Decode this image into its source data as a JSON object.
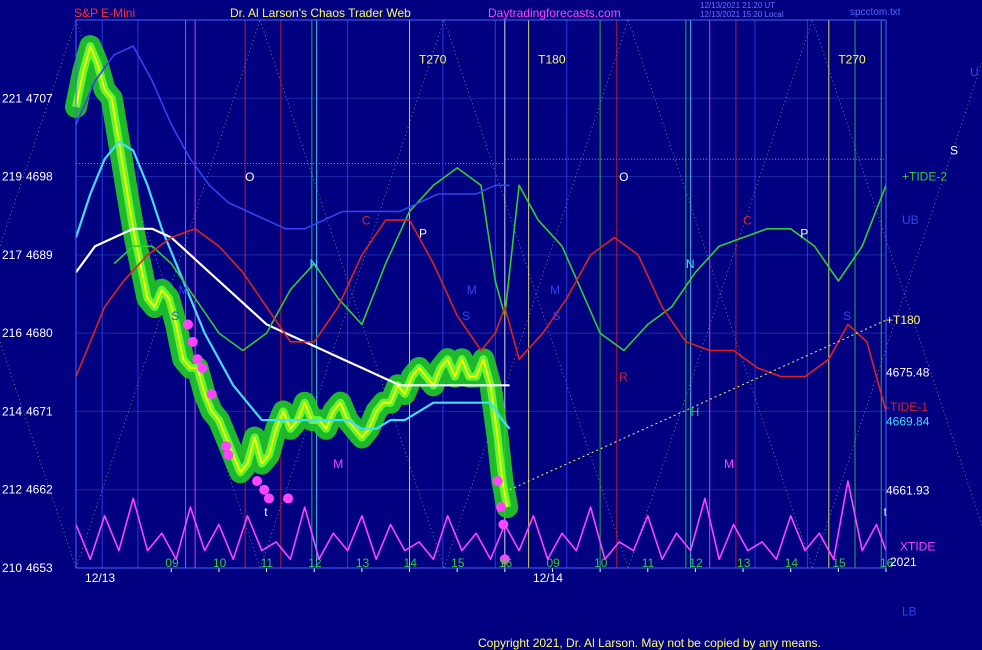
{
  "header": {
    "symbol": "S&P E-Mini",
    "title": "Dr. Al Larson's Chaos Trader Web",
    "site": "Daytradingforecasts.com",
    "timestamp_1": "12/13/2021 21:20 UT",
    "timestamp_2": "12/13/2021 15:20 Local",
    "file": "spcctom.txt"
  },
  "footer": {
    "copyright": "Copyright 2021, Dr. Al Larson. May not be copied by any means."
  },
  "colors": {
    "background": "#000080",
    "grid": "#1a2aa8",
    "frame": "#4466ff",
    "yellow": "#ffff66",
    "cyan": "#44ddff",
    "white": "#ffffff",
    "green": "#33cc33",
    "red": "#dd2222",
    "magenta": "#ff44ff",
    "blue": "#3344ee",
    "glow": "#22cc22",
    "price_line": "#ffff00",
    "dot": "#ff44ff"
  },
  "chart_data": {
    "type": "line",
    "title": "S&P E-Mini",
    "ylim": [
      4653,
      4716
    ],
    "y_ticks": [
      {
        "value": 4707,
        "left": "221",
        "label": "4707"
      },
      {
        "value": 4698,
        "left": "219",
        "label": "4698"
      },
      {
        "value": 4689,
        "left": "217",
        "label": "4689"
      },
      {
        "value": 4680,
        "left": "216",
        "label": "4680"
      },
      {
        "value": 4671,
        "left": "214",
        "label": "4671"
      },
      {
        "value": 4662,
        "left": "212",
        "label": "4662"
      },
      {
        "value": 4653,
        "left": "210",
        "label": "4653"
      }
    ],
    "x_ticks": [
      {
        "x": 3.0,
        "label": "09"
      },
      {
        "x": 4.0,
        "label": "10"
      },
      {
        "x": 5.0,
        "label": "11"
      },
      {
        "x": 6.0,
        "label": "12"
      },
      {
        "x": 7.0,
        "label": "13"
      },
      {
        "x": 8.0,
        "label": "14"
      },
      {
        "x": 9.0,
        "label": "15"
      },
      {
        "x": 10.0,
        "label": "16"
      },
      {
        "x": 11.0,
        "label": "09"
      },
      {
        "x": 12.0,
        "label": "10"
      },
      {
        "x": 13.0,
        "label": "11"
      },
      {
        "x": 14.0,
        "label": "12"
      },
      {
        "x": 15.0,
        "label": "13"
      },
      {
        "x": 16.0,
        "label": "14"
      },
      {
        "x": 17.0,
        "label": "15"
      },
      {
        "x": 18.0,
        "label": "16"
      }
    ],
    "dates": [
      {
        "x": 1.4,
        "label": "12/13"
      },
      {
        "x": 10.8,
        "label": "12/14"
      }
    ],
    "year": "2021",
    "xlim": [
      1.0,
      18.0
    ],
    "right_labels": [
      {
        "text": "U",
        "value": 4710,
        "color": "#3344ee"
      },
      {
        "text": "S",
        "value": 4701,
        "color": "#ffffff"
      },
      {
        "text": "+TIDE-2",
        "value": 4698,
        "color": "#33cc33"
      },
      {
        "text": "UB",
        "value": 4693,
        "color": "#3344ee"
      },
      {
        "text": "+T180",
        "value": 4681.5,
        "color": "#ffff66"
      },
      {
        "text": "4675.48",
        "value": 4675.48,
        "color": "#ffffff"
      },
      {
        "text": "-TIDE-1",
        "value": 4671.5,
        "color": "#dd2222"
      },
      {
        "text": "4669.84",
        "value": 4669.84,
        "color": "#44ddff"
      },
      {
        "text": "4661.93",
        "value": 4661.93,
        "color": "#ffffff"
      },
      {
        "text": "XTIDE",
        "value": 4655.5,
        "color": "#ff44ff"
      },
      {
        "text": "LB",
        "value": 4648,
        "color": "#3344ee"
      }
    ],
    "chart_labels": [
      {
        "text": "T270",
        "x": 8.2,
        "value": 4711,
        "color": "#ffff66"
      },
      {
        "text": "T180",
        "x": 10.7,
        "value": 4711,
        "color": "#ffff66"
      },
      {
        "text": "T270",
        "x": 17.0,
        "value": 4711,
        "color": "#ffff66"
      },
      {
        "text": "O",
        "x": 4.55,
        "value": 4697.5,
        "color": "#ffffff"
      },
      {
        "text": "O",
        "x": 12.4,
        "value": 4697.5,
        "color": "#ffffff"
      },
      {
        "text": "C",
        "x": 7.0,
        "value": 4692.5,
        "color": "#dd2222"
      },
      {
        "text": "C",
        "x": 15.0,
        "value": 4692.5,
        "color": "#dd2222"
      },
      {
        "text": "P",
        "x": 8.2,
        "value": 4691,
        "color": "#ffffff"
      },
      {
        "text": "P",
        "x": 16.2,
        "value": 4691,
        "color": "#ffffff"
      },
      {
        "text": "N",
        "x": 5.9,
        "value": 4687.5,
        "color": "#44ddff"
      },
      {
        "text": "N",
        "x": 13.8,
        "value": 4687.5,
        "color": "#44ddff"
      },
      {
        "text": "M",
        "x": 3.15,
        "value": 4684.5,
        "color": "#3344ee"
      },
      {
        "text": "M",
        "x": 9.2,
        "value": 4684.5,
        "color": "#3344ee"
      },
      {
        "text": "M",
        "x": 10.95,
        "value": 4684.5,
        "color": "#3344ee"
      },
      {
        "text": "S",
        "x": 3.0,
        "value": 4681.5,
        "color": "#3344ee"
      },
      {
        "text": "S",
        "x": 9.1,
        "value": 4681.5,
        "color": "#3344ee"
      },
      {
        "text": "S",
        "x": 11.0,
        "value": 4681.5,
        "color": "#3344ee"
      },
      {
        "text": "S",
        "x": 17.1,
        "value": 4681.5,
        "color": "#3344ee"
      },
      {
        "text": "R",
        "x": 12.4,
        "value": 4674.5,
        "color": "#dd2222"
      },
      {
        "text": "H",
        "x": 13.9,
        "value": 4670.5,
        "color": "#33cc33"
      },
      {
        "text": "M",
        "x": 6.4,
        "value": 4664.5,
        "color": "#ff44ff"
      },
      {
        "text": "M",
        "x": 14.6,
        "value": 4664.5,
        "color": "#ff44ff"
      },
      {
        "text": "t",
        "x": 4.95,
        "value": 4659,
        "color": "#ffffff"
      },
      {
        "text": "t",
        "x": 17.95,
        "value": 4659,
        "color": "#ffffff"
      }
    ],
    "series": [
      {
        "name": "price",
        "color": "#ffff00",
        "glow": true,
        "x": [
          1.0,
          1.15,
          1.3,
          1.45,
          1.6,
          1.75,
          1.9,
          2.05,
          2.2,
          2.35,
          2.5,
          2.65,
          2.8,
          2.95,
          3.1,
          3.25,
          3.4,
          3.55,
          3.7,
          3.85,
          4.0,
          4.15,
          4.3,
          4.45,
          4.6,
          4.75,
          4.9,
          5.05,
          5.2,
          5.35,
          5.5,
          5.65,
          5.8,
          5.95,
          6.1,
          6.25,
          6.4,
          6.55,
          6.7,
          6.85,
          7.0,
          7.15,
          7.3,
          7.45,
          7.6,
          7.75,
          7.9,
          8.05,
          8.2,
          8.35,
          8.5,
          8.65,
          8.8,
          8.95,
          9.1,
          9.25,
          9.4,
          9.55,
          9.7,
          9.85,
          9.95,
          10.05
        ],
        "values": [
          4706,
          4710,
          4713,
          4711,
          4708,
          4707,
          4702,
          4697,
          4692,
          4688,
          4684,
          4683,
          4685,
          4684,
          4681,
          4677,
          4676,
          4676,
          4673,
          4671,
          4670,
          4668,
          4666,
          4664,
          4665,
          4668,
          4665,
          4666,
          4669,
          4671,
          4669,
          4670,
          4672,
          4670,
          4670,
          4669,
          4671,
          4672,
          4670,
          4669,
          4668,
          4669,
          4671,
          4672,
          4672,
          4674,
          4673,
          4675,
          4676,
          4675,
          4674,
          4676,
          4677,
          4675,
          4677,
          4675,
          4675,
          4677,
          4674,
          4668,
          4663,
          4660
        ]
      },
      {
        "name": "cyan",
        "color": "#44ddff",
        "x": [
          1.0,
          1.3,
          1.6,
          1.9,
          2.2,
          2.5,
          2.8,
          3.1,
          3.4,
          3.7,
          4.0,
          4.3,
          4.6,
          4.9,
          5.2,
          5.5,
          5.8,
          6.1,
          6.4,
          6.7,
          7.0,
          7.3,
          7.6,
          7.9,
          8.2,
          8.5,
          8.8,
          9.1,
          9.4,
          9.7,
          9.95,
          10.1
        ],
        "values": [
          4691,
          4696,
          4700,
          4702,
          4701,
          4697,
          4692,
          4688,
          4684,
          4680,
          4677,
          4674,
          4672,
          4670,
          4670,
          4670,
          4670,
          4670,
          4670,
          4670,
          4669,
          4669,
          4670,
          4670,
          4671,
          4672,
          4672,
          4672,
          4672,
          4672,
          4670,
          4669
        ]
      },
      {
        "name": "white",
        "color": "#ffffff",
        "x": [
          1.0,
          1.4,
          1.8,
          2.2,
          2.6,
          3.0,
          3.4,
          3.8,
          4.2,
          4.6,
          5.0,
          5.4,
          5.8,
          6.2,
          6.6,
          7.0,
          7.4,
          7.8,
          8.2,
          8.6,
          9.0,
          9.4,
          9.8,
          10.1
        ],
        "values": [
          4687,
          4690,
          4691,
          4692,
          4692,
          4691,
          4689,
          4687,
          4685,
          4683,
          4681,
          4680,
          4679,
          4678,
          4677,
          4676,
          4675,
          4674,
          4674,
          4674,
          4674,
          4674,
          4674,
          4674
        ]
      },
      {
        "name": "green",
        "color": "#33cc33",
        "x": [
          1.8,
          2.2,
          2.6,
          3.0,
          3.5,
          4.0,
          4.5,
          5.0,
          5.5,
          6.0,
          6.5,
          7.0,
          7.5,
          8.0,
          8.5,
          9.0,
          9.5,
          9.8,
          10.0,
          10.3,
          10.7,
          11.2,
          11.6,
          12.0,
          12.5,
          13.0,
          13.5,
          14.0,
          14.5,
          15.0,
          15.5,
          16.0,
          16.5,
          17.0,
          17.5,
          18.0
        ],
        "values": [
          4688,
          4690,
          4690,
          4688,
          4684,
          4680,
          4678,
          4680,
          4685,
          4688,
          4684,
          4681,
          4688,
          4694,
          4697,
          4699,
          4697,
          4686,
          4682,
          4697,
          4693,
          4690,
          4685,
          4680,
          4678,
          4681,
          4683,
          4687,
          4690,
          4691,
          4692,
          4692,
          4690,
          4686,
          4690,
          4697
        ]
      },
      {
        "name": "red",
        "color": "#dd2222",
        "x": [
          1.0,
          1.3,
          1.6,
          2.0,
          2.5,
          3.0,
          3.5,
          4.0,
          4.5,
          5.0,
          5.5,
          6.0,
          6.5,
          7.0,
          7.5,
          8.0,
          8.5,
          9.0,
          9.5,
          9.8,
          10.0,
          10.3,
          10.8,
          11.3,
          11.8,
          12.3,
          12.8,
          13.3,
          13.8,
          14.3,
          14.8,
          15.3,
          15.8,
          16.3,
          16.8,
          17.2,
          17.6,
          18.0
        ],
        "values": [
          4675,
          4679,
          4683,
          4686,
          4689,
          4691,
          4692,
          4690,
          4687,
          4683,
          4679,
          4679,
          4683,
          4689,
          4693,
          4693,
          4688,
          4682,
          4678,
          4680,
          4683,
          4677,
          4680,
          4684,
          4689,
          4691,
          4689,
          4683,
          4679,
          4678,
          4678,
          4676,
          4675,
          4675,
          4677,
          4681,
          4679,
          4671
        ]
      },
      {
        "name": "blue",
        "color": "#3344ee",
        "x": [
          1.0,
          1.4,
          1.8,
          2.2,
          2.6,
          3.0,
          3.4,
          3.8,
          4.2,
          4.6,
          5.0,
          5.4,
          5.8,
          6.2,
          6.6,
          7.0,
          7.4,
          7.8,
          8.2,
          8.6,
          9.0,
          9.4,
          9.8,
          10.1
        ],
        "values": [
          4704,
          4709,
          4712,
          4713,
          4709,
          4704,
          4700,
          4697,
          4695,
          4694,
          4693,
          4692,
          4692,
          4693,
          4694,
          4694,
          4694,
          4694,
          4695,
          4696,
          4696,
          4696,
          4697,
          4697
        ]
      },
      {
        "name": "XTIDE",
        "color": "#ff44ff",
        "x": [
          1.0,
          1.3,
          1.6,
          1.9,
          2.2,
          2.5,
          2.8,
          3.1,
          3.4,
          3.7,
          4.0,
          4.3,
          4.6,
          4.9,
          5.2,
          5.5,
          5.8,
          6.1,
          6.4,
          6.7,
          7.0,
          7.3,
          7.6,
          7.9,
          8.2,
          8.5,
          8.8,
          9.1,
          9.4,
          9.7,
          10.0,
          10.3,
          10.6,
          10.9,
          11.2,
          11.5,
          11.8,
          12.1,
          12.4,
          12.7,
          13.0,
          13.3,
          13.6,
          13.9,
          14.2,
          14.5,
          14.8,
          15.1,
          15.4,
          15.7,
          16.0,
          16.3,
          16.6,
          16.9,
          17.2,
          17.5,
          17.8,
          18.0
        ],
        "values": [
          4658,
          4654,
          4659,
          4655,
          4661,
          4655,
          4657,
          4654,
          4660,
          4655,
          4658,
          4654,
          4659,
          4655,
          4656,
          4654,
          4660,
          4654,
          4657,
          4655,
          4659,
          4654,
          4658,
          4655,
          4656,
          4654,
          4659,
          4655,
          4657,
          4654,
          4658,
          4655,
          4659,
          4654,
          4657,
          4655,
          4660,
          4654,
          4656,
          4655,
          4659,
          4654,
          4657,
          4655,
          4661,
          4654,
          4658,
          4655,
          4656,
          4654,
          4659,
          4655,
          4657,
          4654,
          4663,
          4655,
          4658,
          4655
        ]
      },
      {
        "name": "T180",
        "color": "#ffff66",
        "dotted": true,
        "x": [
          10.1,
          18.0
        ],
        "values": [
          4662,
          4681.5
        ]
      }
    ],
    "dots": {
      "x": [
        3.35,
        3.45,
        3.55,
        3.65,
        3.85,
        4.15,
        4.2,
        4.8,
        4.95,
        5.05,
        5.45,
        9.85,
        9.92,
        9.97,
        10.0
      ],
      "values": [
        4681,
        4679,
        4677,
        4676,
        4673,
        4667,
        4666,
        4663,
        4662,
        4661,
        4661,
        4663,
        4660,
        4658,
        4654
      ]
    },
    "vlines": [
      {
        "x": 1.55,
        "color": "#3344ee"
      },
      {
        "x": 2.3,
        "color": "#3344ee"
      },
      {
        "x": 3.5,
        "color": "#ff44ff"
      },
      {
        "x": 3.3,
        "color": "#ff44ff"
      },
      {
        "x": 4.55,
        "color": "#dd2222"
      },
      {
        "x": 5.3,
        "color": "#dd2222"
      },
      {
        "x": 5.95,
        "color": "#33cc33"
      },
      {
        "x": 6.05,
        "color": "#44ddff"
      },
      {
        "x": 6.7,
        "color": "#3344ee"
      },
      {
        "x": 8.0,
        "color": "#ffff66"
      },
      {
        "x": 8.7,
        "color": "#3344ee"
      },
      {
        "x": 9.8,
        "color": "#3344ee"
      },
      {
        "x": 10.5,
        "color": "#ffff66"
      },
      {
        "x": 11.3,
        "color": "#3344ee"
      },
      {
        "x": 12.35,
        "color": "#dd2222"
      },
      {
        "x": 12.0,
        "color": "#33cc33"
      },
      {
        "x": 13.8,
        "color": "#33cc33"
      },
      {
        "x": 13.9,
        "color": "#44ddff"
      },
      {
        "x": 14.3,
        "color": "#ff44ff"
      },
      {
        "x": 14.85,
        "color": "#dd2222"
      },
      {
        "x": 15.25,
        "color": "#3344ee"
      },
      {
        "x": 16.35,
        "color": "#3344ee"
      },
      {
        "x": 16.8,
        "color": "#ffff66"
      },
      {
        "x": 17.35,
        "color": "#33cc33"
      },
      {
        "x": 17.9,
        "color": "#33cc33"
      },
      {
        "x": 10.0,
        "color": "#ffffff"
      }
    ],
    "grid": true
  }
}
